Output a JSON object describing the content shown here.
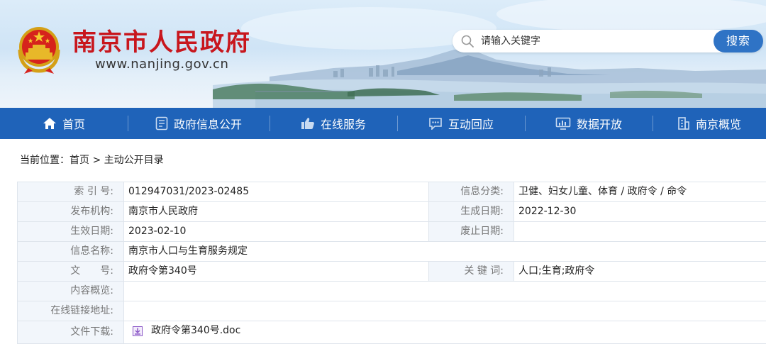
{
  "header": {
    "site_title": "南京市人民政府",
    "site_url": "www.nanjing.gov.cn",
    "emblem_icon": "national-emblem-icon",
    "search": {
      "placeholder": "请输入关键字",
      "button_label": "搜索",
      "icon": "search-icon"
    }
  },
  "nav": {
    "items": [
      {
        "label": "首页",
        "icon": "home-icon"
      },
      {
        "label": "政府信息公开",
        "icon": "document-icon"
      },
      {
        "label": "在线服务",
        "icon": "thumbs-up-icon"
      },
      {
        "label": "互动回应",
        "icon": "chat-icon"
      },
      {
        "label": "数据开放",
        "icon": "monitor-icon"
      },
      {
        "label": "南京概览",
        "icon": "building-icon"
      }
    ]
  },
  "breadcrumb": {
    "prefix": "当前位置：",
    "home": "首页",
    "separator": " > ",
    "current": "主动公开目录"
  },
  "info": {
    "index_label": "索 引 号:",
    "index_value": "012947031/2023-02485",
    "category_label": "信息分类:",
    "category_value": "卫健、妇女儿童、体育 / 政府令 / 命令",
    "publisher_label": "发布机构:",
    "publisher_value": "南京市人民政府",
    "created_label": "生成日期:",
    "created_value": "2022-12-30",
    "effective_label": "生效日期:",
    "effective_value": "2023-02-10",
    "repeal_label": "废止日期:",
    "repeal_value": "",
    "name_label": "信息名称:",
    "name_value": "南京市人口与生育服务规定",
    "docno_label": "文　　号:",
    "docno_value": "政府令第340号",
    "keywords_label": "关 键 词:",
    "keywords_value": "人口;生育;政府令",
    "summary_label": "内容概览:",
    "summary_value": "",
    "link_label": "在线链接地址:",
    "link_value": "",
    "download_label": "文件下载:",
    "download_file": "政府令第340号.doc",
    "download_icon": "download-icon"
  },
  "colors": {
    "brand_red": "#c8161d",
    "nav_blue": "#1f63b9",
    "search_button": "#2f73c5",
    "label_bg": "#f2f6fb"
  }
}
